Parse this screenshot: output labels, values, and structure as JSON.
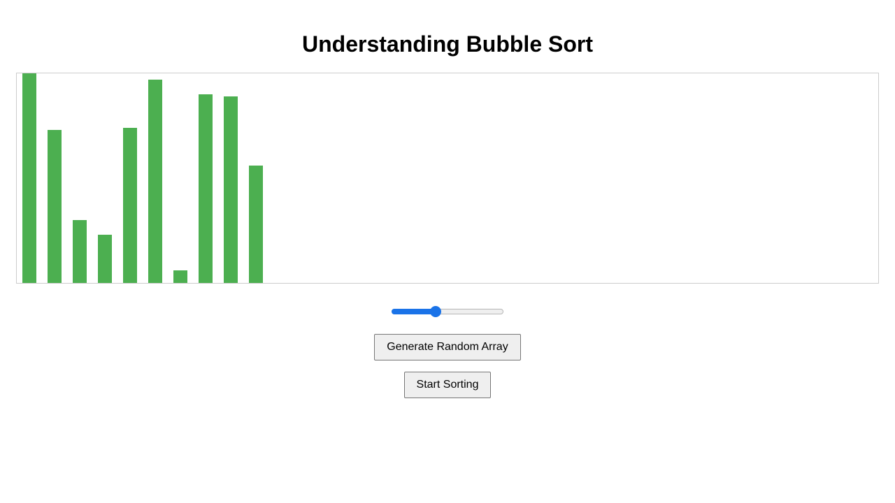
{
  "title": "Understanding Bubble Sort",
  "colors": {
    "bar": "#4caf50",
    "slider_accent": "#1a73e8"
  },
  "chart_data": {
    "type": "bar",
    "values": [
      100,
      73,
      30,
      23,
      74,
      97,
      6,
      90,
      89,
      56
    ],
    "ylim": [
      0,
      100
    ]
  },
  "speed_slider": {
    "value_fraction": 0.38
  },
  "buttons": {
    "generate_label": "Generate Random Array",
    "start_label": "Start Sorting"
  }
}
